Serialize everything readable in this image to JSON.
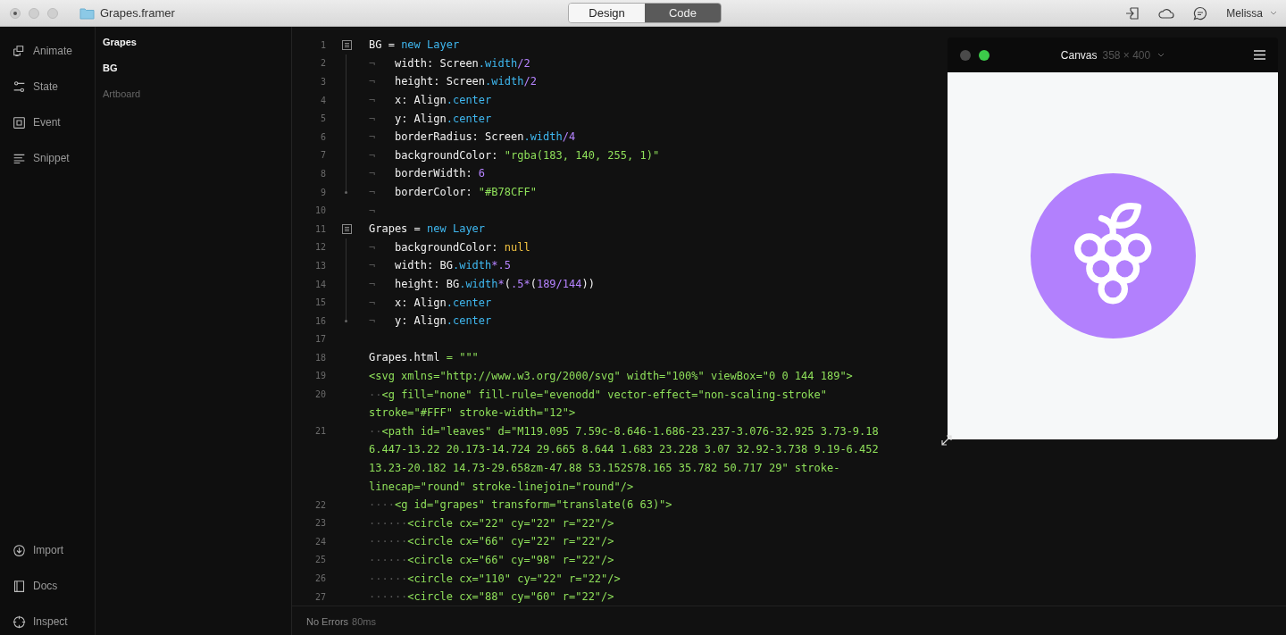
{
  "window": {
    "title": "Grapes.framer"
  },
  "mode_tabs": [
    {
      "label": "Design",
      "selected": false
    },
    {
      "label": "Code",
      "selected": true
    }
  ],
  "user": {
    "name": "Melissa"
  },
  "sidebar": {
    "top": [
      {
        "label": "Animate"
      },
      {
        "label": "State"
      },
      {
        "label": "Event"
      },
      {
        "label": "Snippet"
      }
    ],
    "bottom": [
      {
        "label": "Import"
      },
      {
        "label": "Docs"
      },
      {
        "label": "Inspect"
      }
    ]
  },
  "layers": [
    {
      "name": "Grapes",
      "dimmed": false
    },
    {
      "name": "BG",
      "dimmed": false
    },
    {
      "name": "Artboard",
      "dimmed": true
    }
  ],
  "editor": {
    "lines": [
      {
        "n": "1",
        "kind": "fold_start",
        "rows": [
          [
            {
              "text": "BG = ",
              "kind": "plain"
            },
            {
              "text": "new Layer",
              "kind": "keyword"
            }
          ]
        ]
      },
      {
        "n": "2",
        "kind": "fold_body",
        "rows": [
          [
            {
              "text": "¬",
              "kind": "whitespace"
            },
            {
              "text": "   width: Screen",
              "kind": "plain"
            },
            {
              "text": ".width",
              "kind": "keyword"
            },
            {
              "text": "/2",
              "kind": "number"
            }
          ]
        ]
      },
      {
        "n": "3",
        "kind": "fold_body",
        "rows": [
          [
            {
              "text": "¬",
              "kind": "whitespace"
            },
            {
              "text": "   height: Screen",
              "kind": "plain"
            },
            {
              "text": ".width",
              "kind": "keyword"
            },
            {
              "text": "/2",
              "kind": "number"
            }
          ]
        ]
      },
      {
        "n": "4",
        "kind": "fold_body",
        "rows": [
          [
            {
              "text": "¬",
              "kind": "whitespace"
            },
            {
              "text": "   x: Align",
              "kind": "plain"
            },
            {
              "text": ".center",
              "kind": "keyword"
            }
          ]
        ]
      },
      {
        "n": "5",
        "kind": "fold_body",
        "rows": [
          [
            {
              "text": "¬",
              "kind": "whitespace"
            },
            {
              "text": "   y: Align",
              "kind": "plain"
            },
            {
              "text": ".center",
              "kind": "keyword"
            }
          ]
        ]
      },
      {
        "n": "6",
        "kind": "fold_body",
        "rows": [
          [
            {
              "text": "¬",
              "kind": "whitespace"
            },
            {
              "text": "   borderRadius: Screen",
              "kind": "plain"
            },
            {
              "text": ".width",
              "kind": "keyword"
            },
            {
              "text": "/4",
              "kind": "number"
            }
          ]
        ]
      },
      {
        "n": "7",
        "kind": "fold_body",
        "rows": [
          [
            {
              "text": "¬",
              "kind": "whitespace"
            },
            {
              "text": "   backgroundColor: ",
              "kind": "plain"
            },
            {
              "text": "\"rgba(183, 140, 255, 1)\"",
              "kind": "string"
            }
          ]
        ]
      },
      {
        "n": "8",
        "kind": "fold_body",
        "rows": [
          [
            {
              "text": "¬",
              "kind": "whitespace"
            },
            {
              "text": "   borderWidth: ",
              "kind": "plain"
            },
            {
              "text": "6",
              "kind": "number"
            }
          ]
        ]
      },
      {
        "n": "9",
        "kind": "fold_end",
        "rows": [
          [
            {
              "text": "¬",
              "kind": "whitespace"
            },
            {
              "text": "   borderColor: ",
              "kind": "plain"
            },
            {
              "text": "\"#B78CFF\"",
              "kind": "string"
            }
          ]
        ]
      },
      {
        "n": "10",
        "kind": "plain",
        "rows": [
          [
            {
              "text": "¬",
              "kind": "whitespace"
            }
          ]
        ]
      },
      {
        "n": "11",
        "kind": "fold_start",
        "rows": [
          [
            {
              "text": "Grapes = ",
              "kind": "plain"
            },
            {
              "text": "new Layer",
              "kind": "keyword"
            }
          ]
        ]
      },
      {
        "n": "12",
        "kind": "fold_body",
        "rows": [
          [
            {
              "text": "¬",
              "kind": "whitespace"
            },
            {
              "text": "   backgroundColor: ",
              "kind": "plain"
            },
            {
              "text": "null",
              "kind": "literal"
            }
          ]
        ]
      },
      {
        "n": "13",
        "kind": "fold_body",
        "rows": [
          [
            {
              "text": "¬",
              "kind": "whitespace"
            },
            {
              "text": "   width: BG",
              "kind": "plain"
            },
            {
              "text": ".width",
              "kind": "keyword"
            },
            {
              "text": "*.5",
              "kind": "number"
            }
          ]
        ]
      },
      {
        "n": "14",
        "kind": "fold_body",
        "rows": [
          [
            {
              "text": "¬",
              "kind": "whitespace"
            },
            {
              "text": "   height: BG",
              "kind": "plain"
            },
            {
              "text": ".width",
              "kind": "keyword"
            },
            {
              "text": "*",
              "kind": "number"
            },
            {
              "text": "(",
              "kind": "plain"
            },
            {
              "text": ".5*",
              "kind": "number"
            },
            {
              "text": "(",
              "kind": "plain"
            },
            {
              "text": "189/144",
              "kind": "number"
            },
            {
              "text": "))",
              "kind": "plain"
            }
          ]
        ]
      },
      {
        "n": "15",
        "kind": "fold_body",
        "rows": [
          [
            {
              "text": "¬",
              "kind": "whitespace"
            },
            {
              "text": "   x: Align",
              "kind": "plain"
            },
            {
              "text": ".center",
              "kind": "keyword"
            }
          ]
        ]
      },
      {
        "n": "16",
        "kind": "fold_end",
        "rows": [
          [
            {
              "text": "¬",
              "kind": "whitespace"
            },
            {
              "text": "   y: Align",
              "kind": "plain"
            },
            {
              "text": ".center",
              "kind": "keyword"
            }
          ]
        ]
      },
      {
        "n": "17",
        "kind": "plain"
      },
      {
        "n": "18",
        "kind": "plain",
        "rows": [
          [
            {
              "text": "Grapes.html",
              "kind": "plain"
            },
            {
              "text": " = \"\"\"",
              "kind": "string"
            }
          ]
        ]
      },
      {
        "n": "19",
        "kind": "plain",
        "rows": [
          [
            {
              "text": "<svg xmlns=\"http://www.w3.org/2000/svg\" width=\"100%\" viewBox=\"0 0 144 189\">",
              "kind": "string"
            }
          ]
        ]
      },
      {
        "n": "20",
        "kind": "plain",
        "rows": [
          [
            {
              "text": "··",
              "kind": "whitespace"
            },
            {
              "text": "<g fill=\"none\" fill-rule=\"evenodd\" vector-effect=\"non-scaling-stroke\"",
              "kind": "string"
            }
          ],
          [
            {
              "text": "stroke=\"#FFF\" stroke-width=\"12\">",
              "kind": "string"
            }
          ]
        ]
      },
      {
        "n": "21",
        "kind": "plain",
        "rows": [
          [
            {
              "text": "··",
              "kind": "whitespace"
            },
            {
              "text": "<path id=\"leaves\" d=\"M119.095 7.59c-8.646-1.686-23.237-3.076-32.925 3.73-9.18",
              "kind": "string"
            }
          ],
          [
            {
              "text": "6.447-13.22 20.173-14.724 29.665 8.644 1.683 23.228 3.07 32.92-3.738 9.19-6.452",
              "kind": "string"
            }
          ],
          [
            {
              "text": "13.23-20.182 14.73-29.658zm-47.88 53.152S78.165 35.782 50.717 29\" stroke-",
              "kind": "string"
            }
          ],
          [
            {
              "text": "linecap=\"round\" stroke-linejoin=\"round\"/>",
              "kind": "string"
            }
          ]
        ]
      },
      {
        "n": "22",
        "kind": "plain",
        "rows": [
          [
            {
              "text": "····",
              "kind": "whitespace"
            },
            {
              "text": "<g id=\"grapes\" transform=\"translate(6 63)\">",
              "kind": "string"
            }
          ]
        ]
      },
      {
        "n": "23",
        "kind": "plain",
        "rows": [
          [
            {
              "text": "······",
              "kind": "whitespace"
            },
            {
              "text": "<circle cx=\"22\" cy=\"22\" r=\"22\"/>",
              "kind": "string"
            }
          ]
        ]
      },
      {
        "n": "24",
        "kind": "plain",
        "rows": [
          [
            {
              "text": "······",
              "kind": "whitespace"
            },
            {
              "text": "<circle cx=\"66\" cy=\"22\" r=\"22\"/>",
              "kind": "string"
            }
          ]
        ]
      },
      {
        "n": "25",
        "kind": "plain",
        "rows": [
          [
            {
              "text": "······",
              "kind": "whitespace"
            },
            {
              "text": "<circle cx=\"66\" cy=\"98\" r=\"22\"/>",
              "kind": "string"
            }
          ]
        ]
      },
      {
        "n": "26",
        "kind": "plain",
        "rows": [
          [
            {
              "text": "······",
              "kind": "whitespace"
            },
            {
              "text": "<circle cx=\"110\" cy=\"22\" r=\"22\"/>",
              "kind": "string"
            }
          ]
        ]
      },
      {
        "n": "27",
        "kind": "plain",
        "rows": [
          [
            {
              "text": "······",
              "kind": "whitespace"
            },
            {
              "text": "<circle cx=\"88\" cy=\"60\" r=\"22\"/>",
              "kind": "string"
            }
          ]
        ]
      }
    ]
  },
  "status_bar": {
    "message": "No Errors",
    "time": "80ms"
  },
  "preview": {
    "title": "Canvas",
    "size": "358 × 400",
    "lights": [
      {
        "color": "#4a4a4a"
      },
      {
        "color": "#3ccb4a"
      }
    ]
  }
}
